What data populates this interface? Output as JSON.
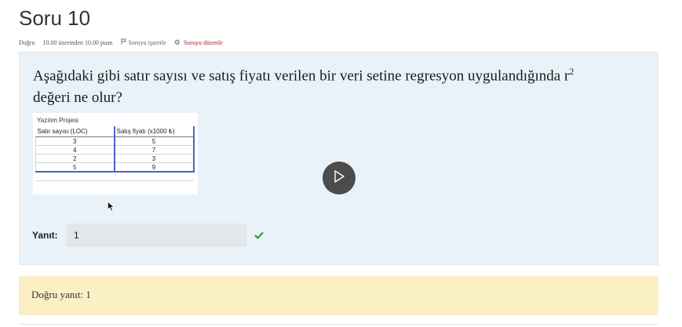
{
  "question": {
    "title": "Soru 10",
    "status": "Doğru",
    "score": "10.00 üzerinden 10.00 puan",
    "flag_label": "Soruyu işaretle",
    "edit_label": "Soruyu düzenle",
    "text": "Aşağıdaki gibi satır sayısı ve satış fiyatı verilen bir veri setine regresyon uygulandığında r",
    "text_sup": "2",
    "text_end": "değeri ne olur?"
  },
  "figure": {
    "title": "Yazılım Projesi",
    "headers": [
      "Satır sayısı (LOC)",
      "Satış fiyatı (x1000 ₺)"
    ],
    "rows": [
      [
        "3",
        "5"
      ],
      [
        "4",
        "7"
      ],
      [
        "2",
        "3"
      ],
      [
        "5",
        "9"
      ]
    ]
  },
  "answer": {
    "label": "Yanıt:",
    "value": "1"
  },
  "feedback": {
    "text": "Doğru yanıt: 1"
  },
  "colors": {
    "question_bg": "#e8f2f8",
    "feedback_bg": "#fbefc5",
    "edit_link": "#a3282f",
    "correct_check": "#2e9a35",
    "table_border": "#4a63c8"
  },
  "icons": {
    "flag": "flag-icon",
    "edit": "gear-icon",
    "correct": "check-icon",
    "play": "play-icon",
    "cursor": "mouse-cursor-icon"
  }
}
